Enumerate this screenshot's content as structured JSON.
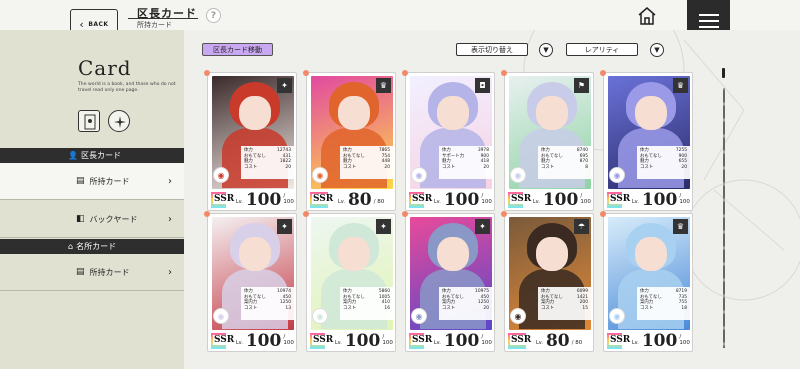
{
  "header": {
    "back_label": "BACK",
    "title": "区長カード",
    "subtitle": "所持カード",
    "help_label": "?"
  },
  "sidebar": {
    "card_title": "Card",
    "card_description": "The world is a book, and those who do not travel read only one page.",
    "sections": [
      {
        "label": "区長カード",
        "items": [
          {
            "label": "所持カード",
            "active": true
          },
          {
            "label": "バックヤード",
            "active": false
          }
        ]
      },
      {
        "label": "名所カード",
        "items": [
          {
            "label": "所持カード",
            "active": false
          }
        ]
      }
    ]
  },
  "controls": {
    "move_button": "区長カード移動",
    "toggle_button": "表示切り替え",
    "sort_select": "レアリティ"
  },
  "stat_labels": {
    "hp": "体力",
    "hospitality": "おもてなし",
    "support": "サポート力",
    "charm": "魅力",
    "guidance": "案内力",
    "cost": "コスト"
  },
  "level_prefix": "Lv.",
  "cards": [
    {
      "rarity": "SSR",
      "level": "100",
      "max": "100",
      "type_icon": "✦",
      "stats": [
        [
          "hp",
          "12743"
        ],
        [
          "hospitality",
          "431"
        ],
        [
          "charm",
          "1822"
        ],
        [
          "cost",
          "20"
        ]
      ],
      "colors": [
        "#c93a2a",
        "#f2e9e4",
        "#3b2a2a"
      ]
    },
    {
      "rarity": "SSR",
      "level": "80",
      "max": "80",
      "type_icon": "♛",
      "stats": [
        [
          "hp",
          "7865"
        ],
        [
          "hospitality",
          "754"
        ],
        [
          "charm",
          "448"
        ],
        [
          "cost",
          "20"
        ]
      ],
      "colors": [
        "#e0642c",
        "#ffd84a",
        "#e24aa0"
      ]
    },
    {
      "rarity": "SSR",
      "level": "100",
      "max": "100",
      "type_icon": "◘",
      "stats": [
        [
          "hp",
          "3978"
        ],
        [
          "support",
          "900"
        ],
        [
          "charm",
          "418"
        ],
        [
          "cost",
          "20"
        ]
      ],
      "colors": [
        "#b4b4e8",
        "#f6d3e4",
        "#f2f0ff"
      ]
    },
    {
      "rarity": "SSR",
      "level": "100",
      "max": "100",
      "type_icon": "⚑",
      "stats": [
        [
          "hp",
          "8740"
        ],
        [
          "hospitality",
          "695"
        ],
        [
          "charm",
          "870"
        ],
        [
          "cost",
          "8"
        ]
      ],
      "colors": [
        "#c8cce8",
        "#8fd4a4",
        "#e8f0f0"
      ]
    },
    {
      "rarity": "SSR",
      "level": "100",
      "max": "100",
      "type_icon": "♛",
      "stats": [
        [
          "hp",
          "7255"
        ],
        [
          "hospitality",
          "900"
        ],
        [
          "charm",
          "655"
        ],
        [
          "cost",
          "20"
        ]
      ],
      "colors": [
        "#9a9ae8",
        "#2c2c6a",
        "#6a72d8"
      ]
    },
    {
      "rarity": "SSR",
      "level": "100",
      "max": "100",
      "type_icon": "✦",
      "stats": [
        [
          "hp",
          "10974"
        ],
        [
          "hospitality",
          "450"
        ],
        [
          "guidance",
          "1250"
        ],
        [
          "cost",
          "13"
        ]
      ],
      "colors": [
        "#d8d0e8",
        "#c33a44",
        "#f4f0f2"
      ]
    },
    {
      "rarity": "SSR",
      "level": "100",
      "max": "100",
      "type_icon": "✦",
      "stats": [
        [
          "hp",
          "5860"
        ],
        [
          "hospitality",
          "1005"
        ],
        [
          "guidance",
          "410"
        ],
        [
          "cost",
          "16"
        ]
      ],
      "colors": [
        "#cfe8d8",
        "#e2f4b4",
        "#eef6f2"
      ]
    },
    {
      "rarity": "SSR",
      "level": "100",
      "max": "100",
      "type_icon": "✦",
      "stats": [
        [
          "hp",
          "10975"
        ],
        [
          "hospitality",
          "450"
        ],
        [
          "guidance",
          "1250"
        ],
        [
          "cost",
          "20"
        ]
      ],
      "colors": [
        "#8a98c8",
        "#5a48c8",
        "#e84a9a"
      ]
    },
    {
      "rarity": "SSR",
      "level": "80",
      "max": "80",
      "type_icon": "☂",
      "stats": [
        [
          "hp",
          "6099"
        ],
        [
          "hospitality",
          "1421"
        ],
        [
          "guidance",
          "200"
        ],
        [
          "cost",
          "15"
        ]
      ],
      "colors": [
        "#3a2a22",
        "#e08a3a",
        "#7a5a3a"
      ]
    },
    {
      "rarity": "SSR",
      "level": "100",
      "max": "100",
      "type_icon": "♛",
      "stats": [
        [
          "hp",
          "8719"
        ],
        [
          "hospitality",
          "735"
        ],
        [
          "guidance",
          "755"
        ],
        [
          "cost",
          "18"
        ]
      ],
      "colors": [
        "#a8d0f0",
        "#4a8ad8",
        "#d8ecfa"
      ]
    }
  ],
  "colors": {
    "accent_purple": "#c8a8f0",
    "dark": "#2e2e2e",
    "dot": "#f28a6a"
  }
}
